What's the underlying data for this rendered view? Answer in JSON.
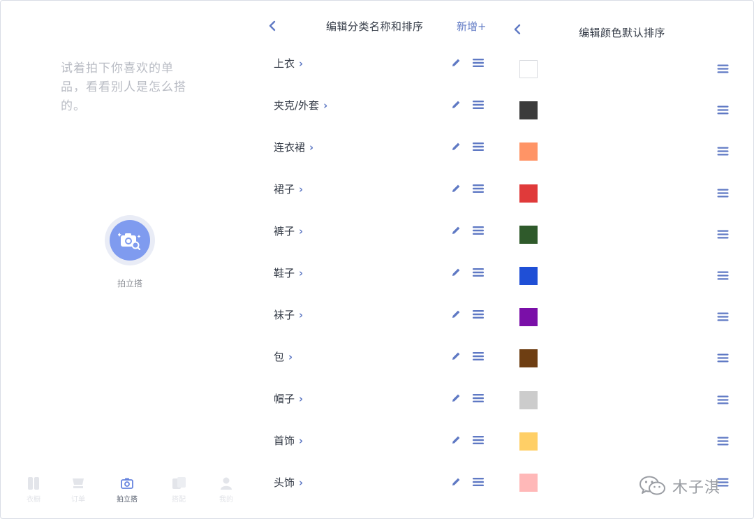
{
  "left_panel": {
    "hint": "试着拍下你喜欢的单品，看看别人是怎么搭的。",
    "shoot_label": "拍立搭",
    "tabs": [
      {
        "label": "衣橱",
        "icon": "wardrobe-icon"
      },
      {
        "label": "订单",
        "icon": "cart-icon"
      },
      {
        "label": "拍立搭",
        "icon": "camera-icon",
        "active": true
      },
      {
        "label": "搭配",
        "icon": "outfit-icon"
      },
      {
        "label": "我的",
        "icon": "person-icon"
      }
    ]
  },
  "category_editor": {
    "back_icon": "chevron-left-icon",
    "title": "编辑分类名称和排序",
    "add_label": "新增+",
    "categories": [
      {
        "label": "上衣"
      },
      {
        "label": "夹克/外套"
      },
      {
        "label": "连衣裙"
      },
      {
        "label": "裙子"
      },
      {
        "label": "裤子"
      },
      {
        "label": "鞋子"
      },
      {
        "label": "袜子"
      },
      {
        "label": "包"
      },
      {
        "label": "帽子"
      },
      {
        "label": "首饰"
      },
      {
        "label": "头饰"
      }
    ],
    "row_icons": {
      "edit": "pencil-icon",
      "reorder": "drag-handle-icon"
    }
  },
  "color_editor": {
    "back_icon": "chevron-left-icon",
    "title": "编辑颜色默认排序",
    "swatches": [
      "#ffffff",
      "#3b3b3b",
      "#ff9466",
      "#e03a3a",
      "#2f5a2b",
      "#1f4fd6",
      "#7a0fa8",
      "#6e3e12",
      "#cccccc",
      "#ffcf66",
      "#ffb8b8"
    ],
    "accent": "#5f79c4"
  },
  "watermark": {
    "text": "木子淇",
    "icon": "wechat-icon"
  }
}
